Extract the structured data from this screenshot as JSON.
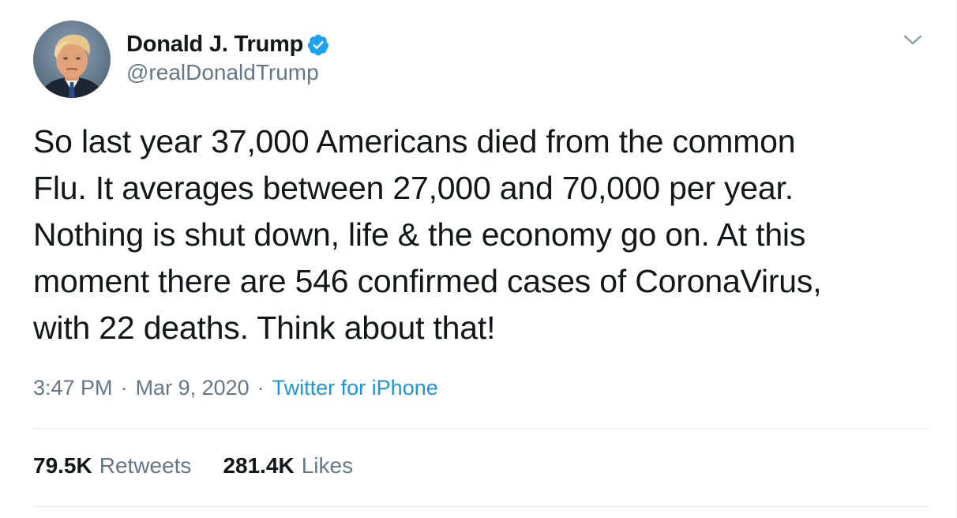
{
  "author": {
    "display_name": "Donald J. Trump",
    "handle": "@realDonaldTrump",
    "verified": true,
    "avatar_icon": "profile-photo"
  },
  "tweet": {
    "text": "So last year 37,000 Americans died from the common\nFlu. It averages between 27,000 and 70,000 per year.\nNothing is shut down, life & the economy go on. At this\nmoment there are 546 confirmed cases of CoronaVirus,\nwith 22 deaths. Think about that!",
    "time": "3:47 PM",
    "separator": "·",
    "date": "Mar 9, 2020",
    "source": "Twitter for iPhone"
  },
  "stats": {
    "retweets_count": "79.5K",
    "retweets_label": "Retweets",
    "likes_count": "281.4K",
    "likes_label": "Likes"
  },
  "colors": {
    "text_primary": "#14171a",
    "text_secondary": "#657786",
    "link_blue": "#1b95e0",
    "verified_blue": "#1da1f2",
    "divider": "#e6ecf0"
  },
  "icons": {
    "verified": "verified-badge-icon",
    "menu": "chevron-down-icon"
  }
}
